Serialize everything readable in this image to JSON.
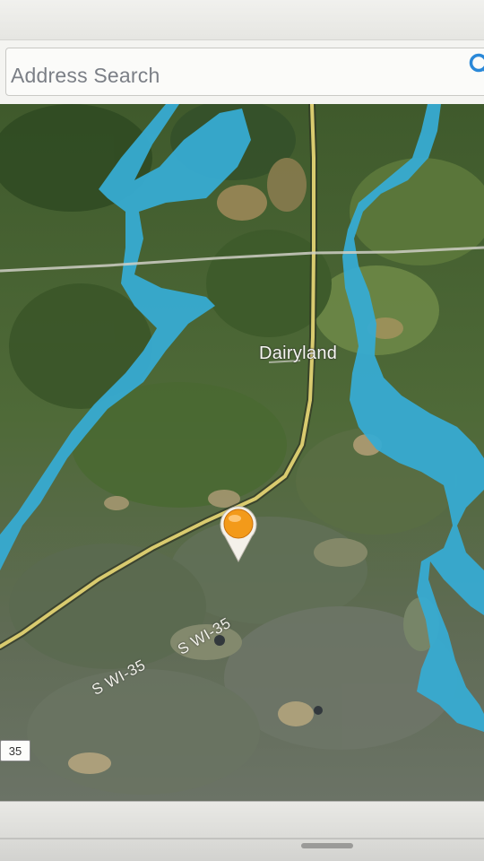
{
  "search": {
    "placeholder": "Address Search",
    "icon": "search-icon"
  },
  "map": {
    "type": "satellite",
    "place_label": "Dairyland",
    "road_labels": [
      "S WI-35",
      "S WI-35"
    ],
    "route_shield": "35",
    "marker": {
      "icon": "location-pin-icon",
      "color": "#f39a1a"
    },
    "colors": {
      "water": "#3aaed3",
      "road": "#d8c86e",
      "forest": "#4a5e3a"
    }
  }
}
